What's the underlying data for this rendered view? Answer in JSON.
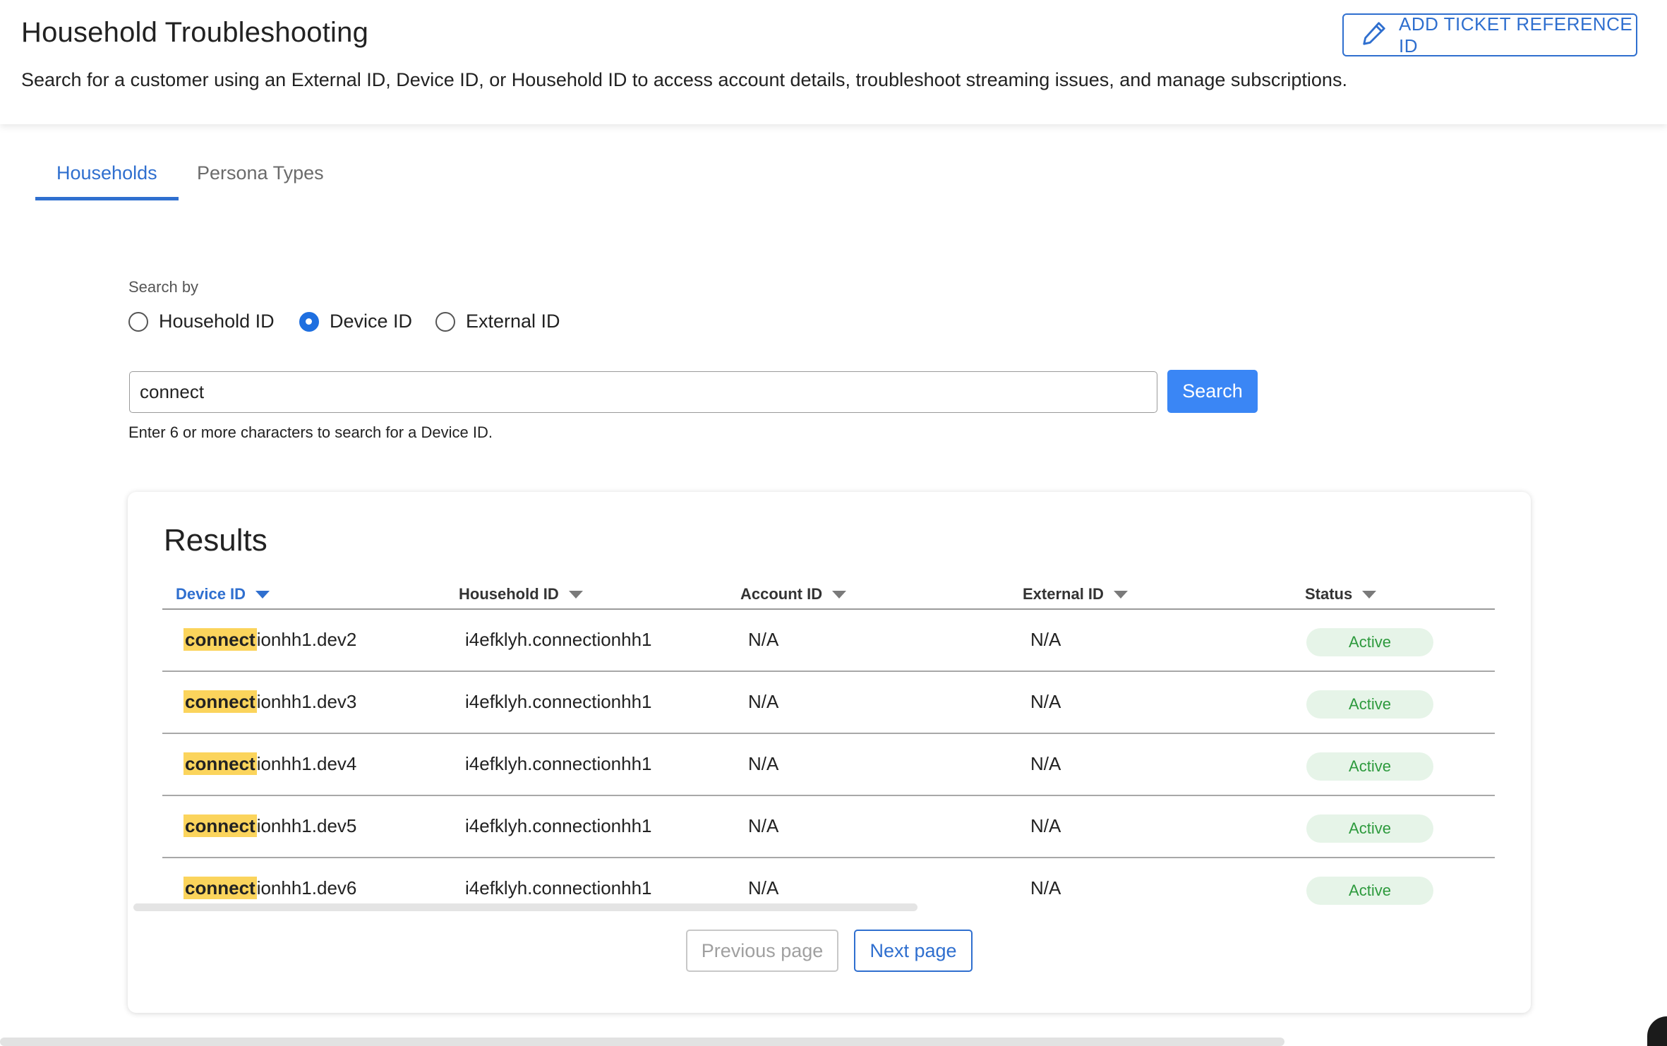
{
  "header": {
    "title": "Household Troubleshooting",
    "subtitle": "Search for a customer using an External ID, Device ID, or Household ID to access account details, troubleshoot streaming issues, and manage subscriptions.",
    "ticket_button_label": "ADD TICKET REFERENCE ID",
    "ticket_button_icon": "pencil-icon"
  },
  "tabs": [
    {
      "label": "Households",
      "active": true
    },
    {
      "label": "Persona Types",
      "active": false
    }
  ],
  "search": {
    "search_by_label": "Search by",
    "options": [
      {
        "label": "Household ID",
        "checked": false
      },
      {
        "label": "Device ID",
        "checked": true
      },
      {
        "label": "External ID",
        "checked": false
      }
    ],
    "input_value": "connect",
    "button_label": "Search",
    "helper_text": "Enter 6 or more characters to search for a Device ID."
  },
  "results": {
    "title": "Results",
    "columns": [
      "Device ID",
      "Household ID",
      "Account ID",
      "External ID",
      "Status"
    ],
    "sorted_column": "Device ID",
    "highlight_term": "connect",
    "rows": [
      {
        "device_match": "connect",
        "device_rest": "ionhh1.dev2",
        "household_id": "i4efklyh.connectionhh1",
        "account_id": "N/A",
        "external_id": "N/A",
        "status": "Active"
      },
      {
        "device_match": "connect",
        "device_rest": "ionhh1.dev3",
        "household_id": "i4efklyh.connectionhh1",
        "account_id": "N/A",
        "external_id": "N/A",
        "status": "Active"
      },
      {
        "device_match": "connect",
        "device_rest": "ionhh1.dev4",
        "household_id": "i4efklyh.connectionhh1",
        "account_id": "N/A",
        "external_id": "N/A",
        "status": "Active"
      },
      {
        "device_match": "connect",
        "device_rest": "ionhh1.dev5",
        "household_id": "i4efklyh.connectionhh1",
        "account_id": "N/A",
        "external_id": "N/A",
        "status": "Active"
      },
      {
        "device_match": "connect",
        "device_rest": "ionhh1.dev6",
        "household_id": "i4efklyh.connectionhh1",
        "account_id": "N/A",
        "external_id": "N/A",
        "status": "Active"
      }
    ],
    "pagination": {
      "previous_label": "Previous page",
      "previous_enabled": false,
      "next_label": "Next page",
      "next_enabled": true
    }
  },
  "colors": {
    "accent": "#2f6fcf",
    "primary_button": "#3a86f5",
    "highlight": "#fbd45c",
    "status_active_bg": "#e6f4e8",
    "status_active_text": "#2d9a3d"
  }
}
